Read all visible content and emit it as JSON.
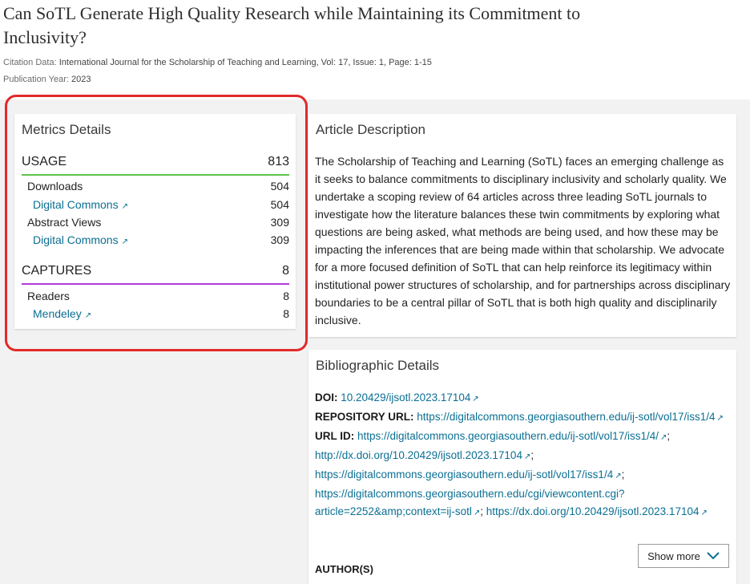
{
  "article": {
    "title": "Can SoTL Generate High Quality Research while Maintaining its Commitment to Inclusivity?",
    "citation_label": "Citation Data:",
    "citation_value": "International Journal for the Scholarship of Teaching and Learning, Vol: 17, Issue: 1, Page: 1-15",
    "year_label": "Publication Year:",
    "year_value": "2023"
  },
  "metrics": {
    "title": "Metrics Details",
    "usage": {
      "label": "USAGE",
      "total": "813",
      "downloads": {
        "label": "Downloads",
        "value": "504"
      },
      "downloads_source": {
        "label": "Digital Commons",
        "value": "504"
      },
      "abstract_views": {
        "label": "Abstract Views",
        "value": "309"
      },
      "abstract_source": {
        "label": "Digital Commons",
        "value": "309"
      }
    },
    "captures": {
      "label": "CAPTURES",
      "total": "8",
      "readers": {
        "label": "Readers",
        "value": "8"
      },
      "readers_source": {
        "label": "Mendeley",
        "value": "8"
      }
    }
  },
  "description": {
    "title": "Article Description",
    "text": "The Scholarship of Teaching and Learning (SoTL) faces an emerging challenge as it seeks to balance commitments to disciplinary inclusivity and scholarly quality. We undertake a scoping review of 64 articles across three leading SoTL journals to investigate how the literature balances these twin commitments by exploring what questions are being asked, what methods are being used, and how these may be impacting the inferences that are being made within that scholarship. We advocate for a more focused definition of SoTL that can help reinforce its legitimacy within institutional power structures of scholarship, and for partnerships across disciplinary boundaries to be a central pillar of SoTL that is both high quality and disciplinarily inclusive."
  },
  "biblio": {
    "title": "Bibliographic Details",
    "doi_label": "DOI:",
    "doi_value": "10.20429/ijsotl.2023.17104",
    "repo_label": "REPOSITORY URL:",
    "repo_value": "https://digitalcommons.georgiasouthern.edu/ij-sotl/vol17/iss1/4",
    "urlid_label": "URL ID:",
    "urlid_1": "https://digitalcommons.georgiasouthern.edu/ij-sotl/vol17/iss1/4/",
    "urlid_2": "http://dx.doi.org/10.20429/ijsotl.2023.17104",
    "urlid_3": "https://digitalcommons.georgiasouthern.edu/ij-sotl/vol17/iss1/4",
    "urlid_4": "https://digitalcommons.georgiasouthern.edu/cgi/viewcontent.cgi?article=2252&amp;context=ij-sotl",
    "urlid_5": "https://dx.doi.org/10.20429/ijsotl.2023.17104",
    "external_glyph": "↗",
    "separator": ";",
    "author_label": "AUTHOR(S)",
    "show_more": "Show more"
  },
  "colors": {
    "usage_rule": "#5ec34b",
    "captures_rule": "#b03ee0",
    "link": "#0b6f93",
    "highlight": "#e12a2a"
  }
}
